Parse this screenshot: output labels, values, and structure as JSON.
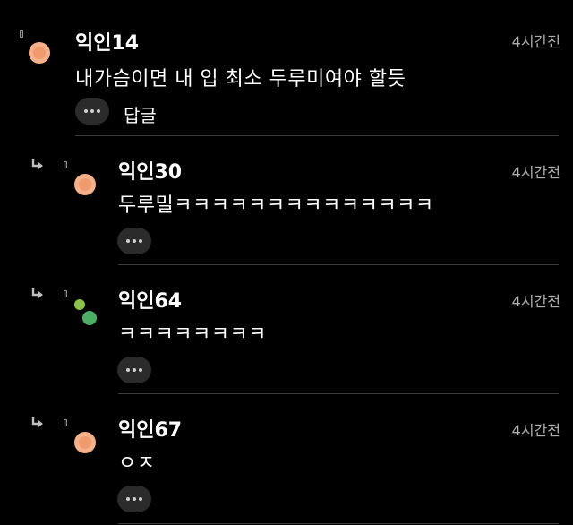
{
  "comments": [
    {
      "nickname": "익인14",
      "time": "4시간전",
      "text": "내가슴이면 내 입 최소 두루미여야 할듯",
      "reply_label": "답글"
    },
    {
      "nickname": "익인30",
      "time": "4시간전",
      "text": "두루밀ㅋㅋㅋㅋㅋㅋㅋㅋㅋㅋㅋㅋㅋㅋ"
    },
    {
      "nickname": "익인64",
      "time": "4시간전",
      "text": "ㅋㅋㅋㅋㅋㅋㅋㅋ"
    },
    {
      "nickname": "익인67",
      "time": "4시간전",
      "text": "ㅇㅈ"
    }
  ],
  "icons": {
    "reply_arrow": "reply-arrow-icon",
    "more": "more-dots-icon"
  },
  "colors": {
    "background": "#000000",
    "avatar_orange": "#f6b08a",
    "avatar_green_light": "#8bc34a",
    "avatar_green": "#4caf65",
    "time_text": "#b0b0b0",
    "button_bg": "#2b2b2b",
    "divider": "#3a3a3a"
  }
}
